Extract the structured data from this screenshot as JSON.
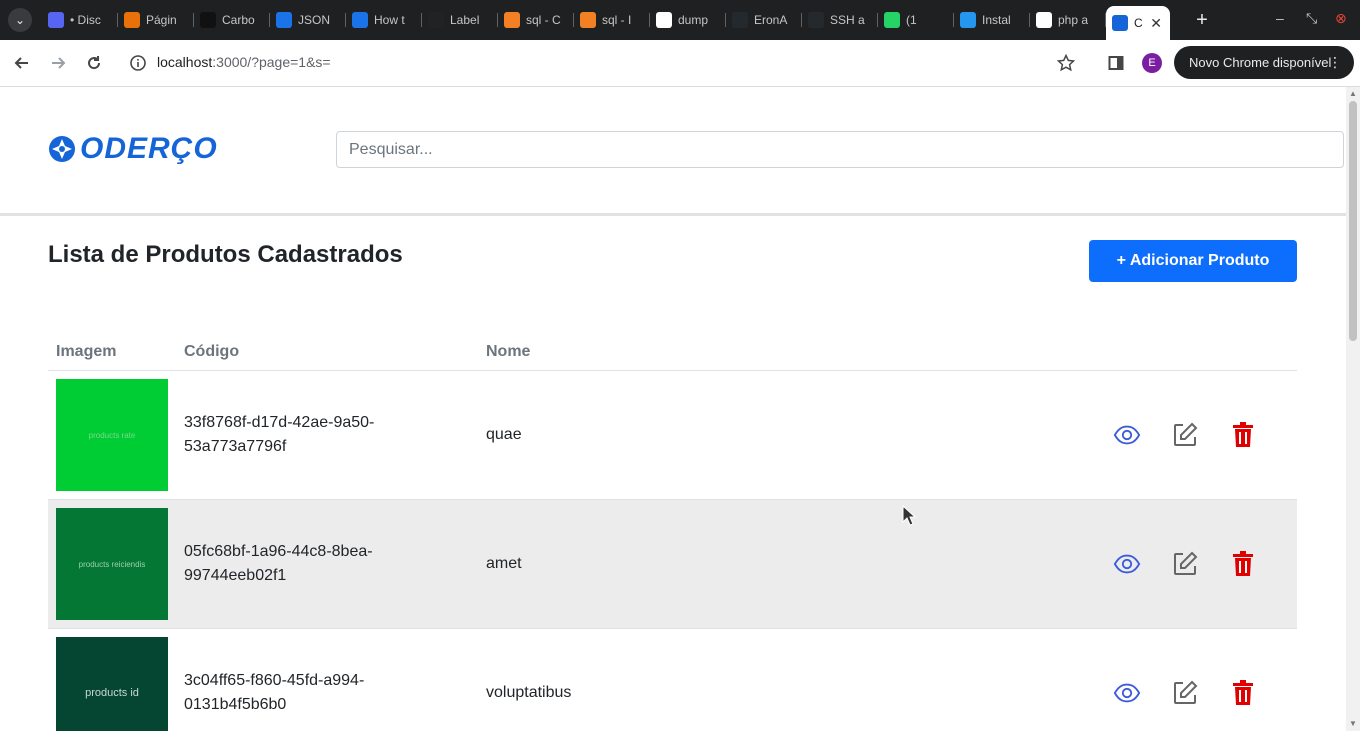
{
  "browser": {
    "tabs": [
      {
        "label": "• Disc",
        "icon": "discord-icon",
        "color": "#5865f2"
      },
      {
        "label": "Págin",
        "icon": "page-icon",
        "color": "#e8710a"
      },
      {
        "label": "Carbo",
        "icon": "carbon-icon",
        "color": "#111111"
      },
      {
        "label": "JSON",
        "icon": "check-icon",
        "color": "#1a73e8"
      },
      {
        "label": "How t",
        "icon": "dot-icon",
        "color": "#1a73e8"
      },
      {
        "label": "Label",
        "icon": "label-icon",
        "color": "#222222"
      },
      {
        "label": "sql - C",
        "icon": "stackoverflow-icon",
        "color": "#f48024"
      },
      {
        "label": "sql - I",
        "icon": "stackoverflow-icon",
        "color": "#f48024"
      },
      {
        "label": "dump",
        "icon": "google-icon",
        "color": "#ffffff"
      },
      {
        "label": "EronA",
        "icon": "github-icon",
        "color": "#24292e"
      },
      {
        "label": "SSH a",
        "icon": "github-icon",
        "color": "#24292e"
      },
      {
        "label": "(1",
        "icon": "whatsapp-icon",
        "color": "#25d366"
      },
      {
        "label": "Instal",
        "icon": "docker-icon",
        "color": "#2496ed"
      },
      {
        "label": "php a",
        "icon": "google-icon",
        "color": "#ffffff"
      }
    ],
    "active_tab_label": "C",
    "url_host": "localhost",
    "url_rest": ":3000/?page=1&s=",
    "profile_initial": "E",
    "update_label": "Novo Chrome disponível"
  },
  "header": {
    "logo_text": "ODERÇO",
    "search_placeholder": "Pesquisar..."
  },
  "main": {
    "title": "Lista de Produtos Cadastrados",
    "add_button": "+ Adicionar Produto",
    "columns": [
      "Imagem",
      "Código",
      "Nome"
    ],
    "products": [
      {
        "image_text": "products rate",
        "image_color": "#00cc33",
        "image_text_color": "#7ad98f",
        "code": "33f8768f-d17d-42ae-9a50-53a773a7796f",
        "name": "quae"
      },
      {
        "image_text": "products reiciendis",
        "image_color": "#047735",
        "image_text_color": "#9ad1a8",
        "code": "05fc68bf-1a96-44c8-8bea-99744eeb02f1",
        "name": "amet"
      },
      {
        "image_text": "products id",
        "image_color": "#054632",
        "image_text_color": "#c8d8d0",
        "code": "3c04ff65-f860-45fd-a994-0131b4f5b6b0",
        "name": "voluptatibus"
      }
    ]
  },
  "colors": {
    "view_icon": "#3b5bdb",
    "edit_icon": "#666666",
    "delete_icon": "#e00000",
    "primary": "#0d6efd"
  }
}
